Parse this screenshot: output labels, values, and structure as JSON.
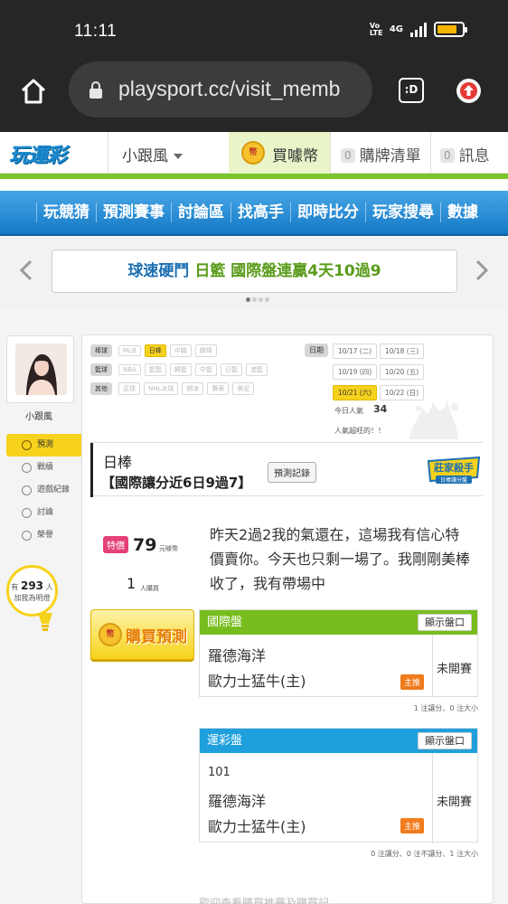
{
  "status_bar": {
    "time": "11:11",
    "volte": "Vo LTE",
    "network": "4G"
  },
  "browser": {
    "url": "playsport.cc/visit_memb",
    "tabs_label": ":D"
  },
  "header": {
    "logo": "玩運彩",
    "user_dropdown": "小跟風",
    "coin_icon_text": "幣",
    "coin_label": "買噱幣",
    "cart_count": "0",
    "cart_label": "購牌清單",
    "msg_count": "0",
    "msg_label": "訊息"
  },
  "nav": {
    "items": [
      "玩競猜",
      "預測賽事",
      "討論區",
      "找高手",
      "即時比分",
      "玩家搜尋",
      "數據"
    ]
  },
  "promo": {
    "part1": "球速硬鬥",
    "part2": "日籃 國際盤連贏4天10過9"
  },
  "profile": {
    "name": "小跟風",
    "menu": [
      "預測",
      "戰績",
      "遊戲紀錄",
      "討論",
      "榮譽"
    ],
    "fans_prefix": "有",
    "fans_count": "293",
    "fans_unit": "人",
    "fans_suffix": "加我為明燈"
  },
  "filters": {
    "rows": [
      {
        "category": "棒球",
        "chips": [
          "MLB",
          "日棒",
          "中職",
          "韓棒"
        ],
        "active": 1
      },
      {
        "category": "籃球",
        "chips": [
          "NBA",
          "籃籃",
          "韓籃",
          "中籃",
          "日籃",
          "澳籃"
        ],
        "active": -1
      },
      {
        "category": "其他",
        "chips": [
          "足球",
          "NHL冰球",
          "網冰",
          "賽車",
          "美足"
        ],
        "active": -1
      }
    ],
    "date_label": "日期",
    "dates": [
      "10/17 (二)",
      "10/18 (三)",
      "10/19 (四)",
      "10/20 (五)",
      "10/21 (六)",
      "10/22 (日)"
    ],
    "active_date": 4
  },
  "popularity": {
    "label": "今日人氣",
    "count": "34",
    "text": "人氣超旺的！！"
  },
  "prediction": {
    "league": "日棒",
    "title": "【國際讓分近6日9過7】",
    "record_btn": "預測記錄",
    "badge_top": "莊家殺手",
    "badge_sub": "日棒讓分盤",
    "price_tag": "特價",
    "price": "79",
    "price_unit": "元噱幣",
    "buyers": "1",
    "buyers_unit": "人購買",
    "buy_label": "購買預測",
    "description": "昨天2過2我的氣還在，這場我有信心特價賣你。今天也只剩一場了。我剛剛美棒收了，我有帶場中"
  },
  "markets": [
    {
      "title": "國際盤",
      "show_btn": "顯示盤口",
      "color": "#78bd1e",
      "number": "",
      "team1": "羅德海洋",
      "team2": "歐力士猛牛(主)",
      "main_tag": "主推",
      "status": "未開賽",
      "note": "1 注讓分、0 注大小"
    },
    {
      "title": "運彩盤",
      "show_btn": "顯示盤口",
      "color": "#1fa0dd",
      "number": "101",
      "team1": "羅德海洋",
      "team2": "歐力士猛牛(主)",
      "main_tag": "主推",
      "status": "未開賽",
      "note": "0 注讓分、0 注不讓分、1 注大小"
    }
  ],
  "bottom_hint": "歡迎查看購買推薦及購買記",
  "colors": {
    "accent_green": "#7bc52a",
    "nav_blue": "#1479c5",
    "highlight_yellow": "#f7d21c",
    "tag_orange": "#f07b1c",
    "price_pink": "#e4407a"
  }
}
